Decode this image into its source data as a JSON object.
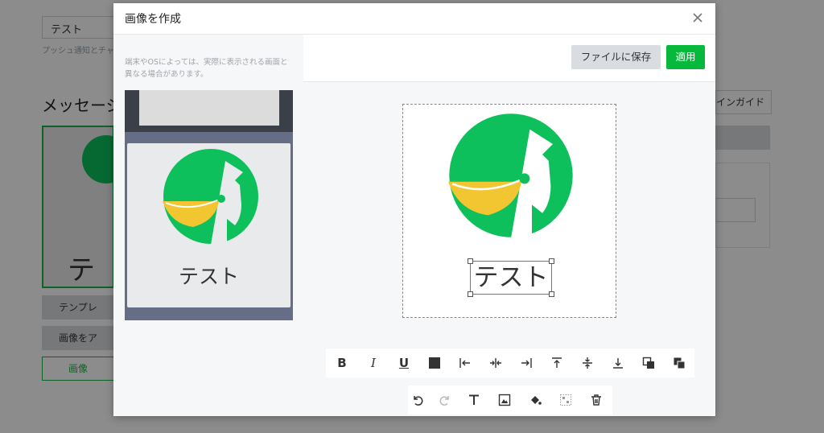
{
  "background": {
    "input_value": "テスト",
    "helper_text": "プッシュ通知とチャ",
    "section_heading": "メッセージ",
    "preview_text": "テキ",
    "template_button": "テンプレ",
    "image_button": "画像をア",
    "image_outline_button": "画像",
    "guide_button": "インガイド"
  },
  "modal": {
    "title": "画像を作成",
    "note": "端末やOSによっては、実際に表示される画面と異なる場合があります。",
    "phone_preview_text": "テスト",
    "canvas_text": "テスト",
    "save_label": "ファイルに保存",
    "apply_label": "適用"
  },
  "toolbar": {
    "row1": [
      {
        "name": "bold-button",
        "icon": "bold-icon",
        "glyph": "B"
      },
      {
        "name": "italic-button",
        "icon": "italic-icon",
        "glyph": "I"
      },
      {
        "name": "underline-button",
        "icon": "underline-icon",
        "glyph": "U"
      },
      {
        "name": "text-color-button",
        "icon": "color-square-icon",
        "glyph": ""
      },
      {
        "name": "align-left-button",
        "icon": "align-left-icon",
        "glyph": ""
      },
      {
        "name": "align-center-button",
        "icon": "align-center-icon",
        "glyph": ""
      },
      {
        "name": "align-right-button",
        "icon": "align-right-icon",
        "glyph": ""
      },
      {
        "name": "align-top-button",
        "icon": "align-top-icon",
        "glyph": ""
      },
      {
        "name": "align-middle-button",
        "icon": "align-middle-icon",
        "glyph": ""
      },
      {
        "name": "align-bottom-button",
        "icon": "align-bottom-icon",
        "glyph": ""
      },
      {
        "name": "bring-front-button",
        "icon": "bring-front-icon",
        "glyph": ""
      },
      {
        "name": "send-back-button",
        "icon": "send-back-icon",
        "glyph": ""
      }
    ],
    "row2": [
      {
        "name": "undo-button",
        "icon": "undo-icon"
      },
      {
        "name": "redo-button",
        "icon": "redo-icon"
      },
      {
        "name": "add-text-button",
        "icon": "text-icon"
      },
      {
        "name": "add-image-button",
        "icon": "image-icon"
      },
      {
        "name": "fill-button",
        "icon": "paint-bucket-icon"
      },
      {
        "name": "transparency-button",
        "icon": "transparency-icon"
      },
      {
        "name": "delete-button",
        "icon": "trash-icon"
      }
    ]
  },
  "colors": {
    "brand_green": "#06b83b",
    "logo_green": "#0ec05c",
    "logo_yellow": "#f2c630"
  }
}
